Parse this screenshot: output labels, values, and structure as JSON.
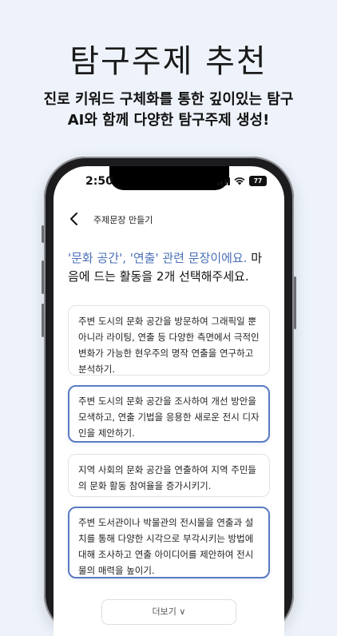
{
  "promo": {
    "title": "탐구주제 추천",
    "subtitle_line1": "진로 키워드 구체화를 통한 깊이있는 탐구",
    "subtitle_line2": "AI와 함께 다양한 탐구주제 생성!"
  },
  "status_bar": {
    "time": "2:50",
    "battery": "77"
  },
  "nav": {
    "title": "주제문장 만들기"
  },
  "question": {
    "highlight": "'문화 공간', '연출' 관련 문장이에요.",
    "rest": " 마음에 드는 활동을 2개 선택해주세요."
  },
  "options": [
    {
      "text": "주변 도시의 문화 공간을 방문하여 그래픽일 뿐 아니라 라이팅, 연출 등 다양한 측면에서 극적인 변화가 가능한 현우주의 명작 연출을 연구하고 분석하기.",
      "selected": false
    },
    {
      "text": "주변 도시의 문화 공간을 조사하여 개선 방안을 모색하고, 연출 기법을 응용한 새로운 전시 디자인을 제안하기.",
      "selected": true
    },
    {
      "text": "지역 사회의 문화 공간을 연출하여 지역 주민들의 문화 활동 참여율을 증가시키기.",
      "selected": false
    },
    {
      "text": "주변 도서관이나 박물관의 전시물을 연출과 설치를 통해 다양한 시각으로 부각시키는 방법에 대해 조사하고 연출 아이디어를 제안하여 전시물의 매력을 높이기.",
      "selected": true
    }
  ],
  "more_button": "더보기 ∨",
  "colors": {
    "accent": "#5a7bc2",
    "highlight_text": "#4a6fb5",
    "background": "#eef3fb"
  }
}
